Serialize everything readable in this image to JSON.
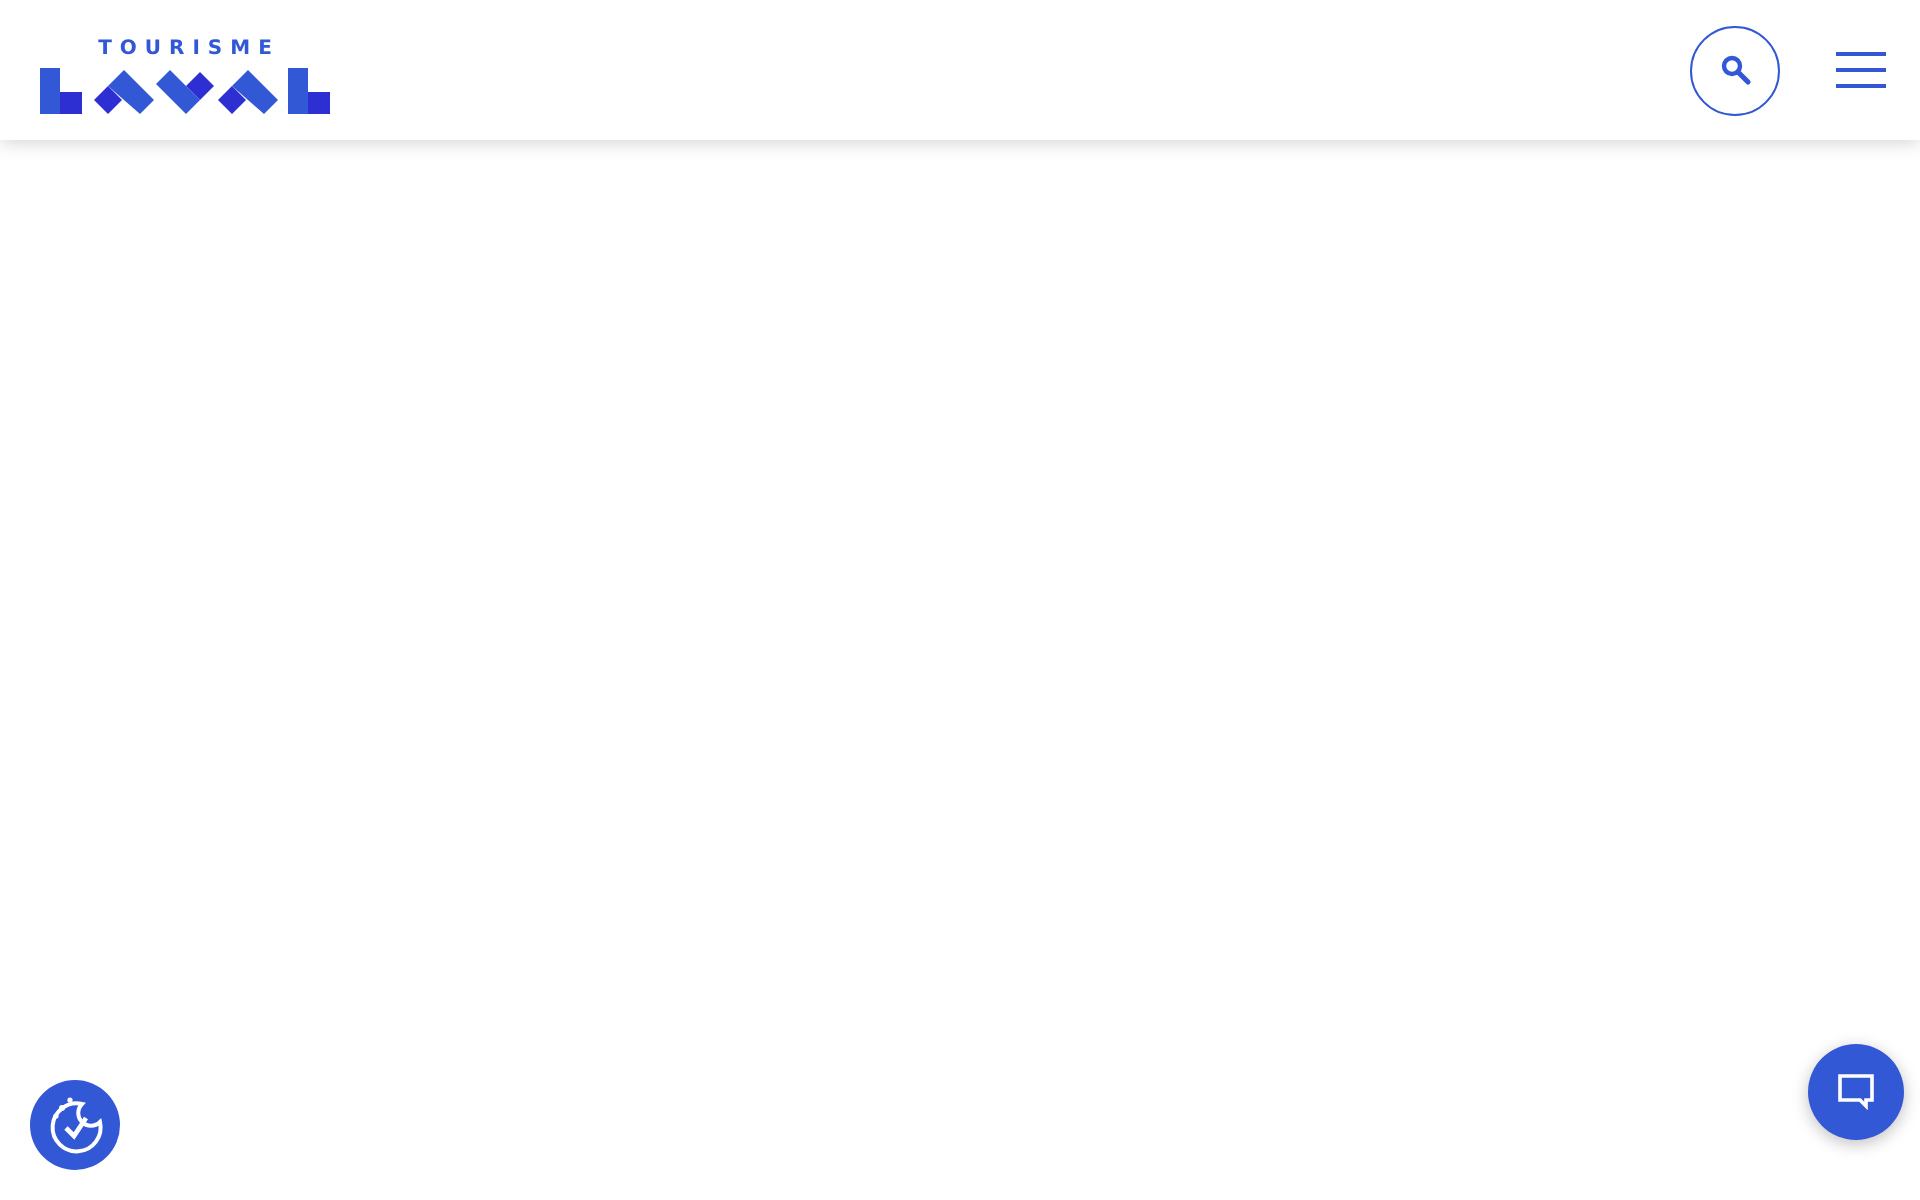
{
  "header": {
    "logo_text": "TOURISME"
  }
}
